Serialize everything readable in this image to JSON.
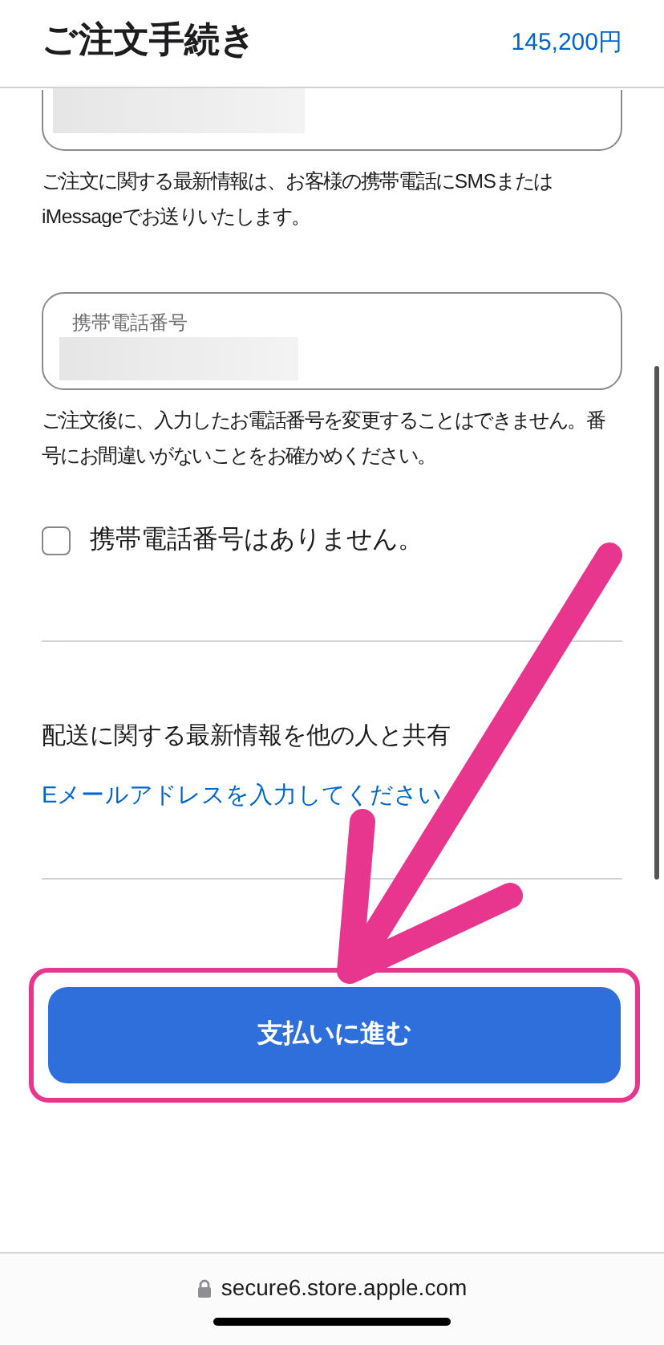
{
  "header": {
    "title": "ご注文手続き",
    "total": "145,200円"
  },
  "email_note": "ご注文に関する最新情報は、お客様の携帯電話にSMSまたはiMessageでお送りいたします。",
  "phone_field": {
    "label": "携帯電話番号"
  },
  "phone_note": "ご注文後に、入力したお電話番号を変更することはできません。番号にお間違いがないことをお確かめください。",
  "no_phone_checkbox": {
    "label": "携帯電話番号はありません。",
    "checked": false
  },
  "share": {
    "heading": "配送に関する最新情報を他の人と共有",
    "link": "Eメールアドレスを入力してください"
  },
  "pay_button": {
    "label": "支払いに進む"
  },
  "address_bar": {
    "url": "secure6.store.apple.com"
  }
}
